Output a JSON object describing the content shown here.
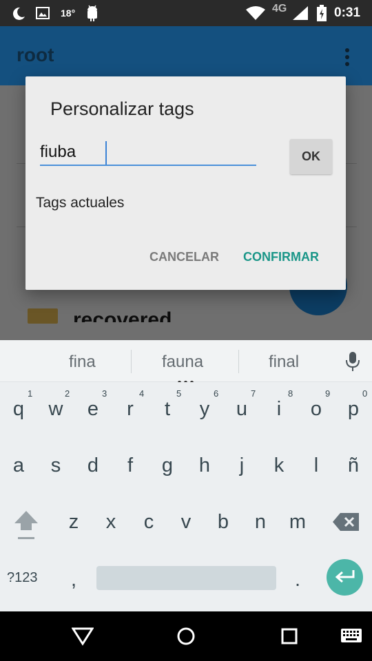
{
  "status_bar": {
    "temperature": "18°",
    "network": "4G",
    "time": "0:31",
    "icons": [
      "moon-icon",
      "image-icon",
      "android-icon",
      "wifi-icon",
      "signal-icon",
      "battery-icon"
    ]
  },
  "app_bar": {
    "title": "root",
    "menu_icon": "overflow-menu-icon"
  },
  "background_list": {
    "folder_name": "recovered"
  },
  "dialog": {
    "title": "Personalizar tags",
    "input_value": "fiuba",
    "ok_label": "OK",
    "current_tags_label": "Tags actuales",
    "cancel_label": "CANCELAR",
    "confirm_label": "CONFIRMAR"
  },
  "keyboard": {
    "suggestions": [
      "fina",
      "fauna",
      "final"
    ],
    "row1": [
      {
        "key": "q",
        "hint": "1"
      },
      {
        "key": "w",
        "hint": "2"
      },
      {
        "key": "e",
        "hint": "3"
      },
      {
        "key": "r",
        "hint": "4"
      },
      {
        "key": "t",
        "hint": "5"
      },
      {
        "key": "y",
        "hint": "6"
      },
      {
        "key": "u",
        "hint": "7"
      },
      {
        "key": "i",
        "hint": "8"
      },
      {
        "key": "o",
        "hint": "9"
      },
      {
        "key": "p",
        "hint": "0"
      }
    ],
    "row2": [
      "a",
      "s",
      "d",
      "f",
      "g",
      "h",
      "j",
      "k",
      "l",
      "ñ"
    ],
    "row3": [
      "z",
      "x",
      "c",
      "v",
      "b",
      "n",
      "m"
    ],
    "symbols_label": "?123",
    "comma": ",",
    "period": "."
  },
  "colors": {
    "app_bar": "#14507f",
    "accent": "#1a9688",
    "enter_key": "#4cb6a8",
    "input_underline": "#4a90d9"
  }
}
